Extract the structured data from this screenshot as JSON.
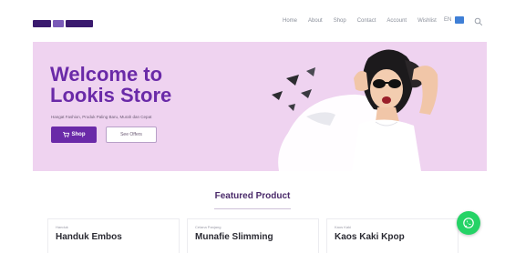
{
  "nav": {
    "links": [
      "Home",
      "About",
      "Shop",
      "Contact",
      "Account",
      "Wishlist"
    ],
    "language": "EN",
    "icons": [
      "flag-icon",
      "search-icon"
    ]
  },
  "hero": {
    "title": "Welcome to\nLookis Store",
    "subtitle": "Hangat Fashion, Produk Paling Baru, Murah dan Cepat",
    "shop_button": "Shop",
    "offers_button": "See Offers",
    "background_color": "#efd3f0",
    "accent_color": "#6a2aa8"
  },
  "featured": {
    "title": "Featured Product",
    "products": [
      {
        "category": "Handuk",
        "name": "Handuk Embos"
      },
      {
        "category": "Celana Panjang",
        "name": "Munafie Slimming"
      },
      {
        "category": "Kaos Kaki",
        "name": "Kaos Kaki Kpop"
      }
    ]
  },
  "whatsapp_color": "#25d366"
}
